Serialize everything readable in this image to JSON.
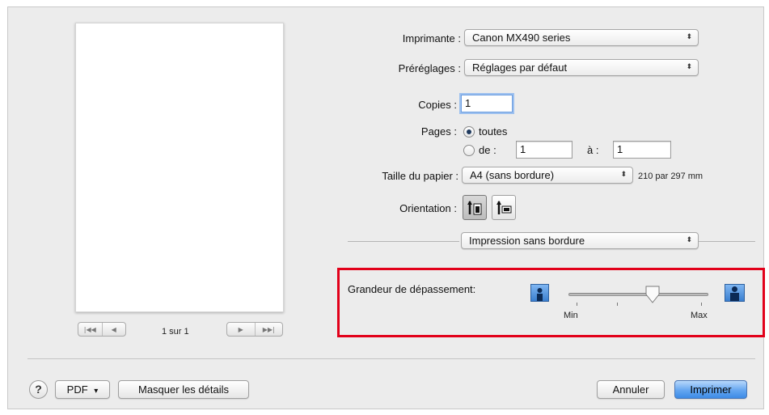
{
  "preview": {
    "nav_first": "|◀◀",
    "nav_prev": "◀",
    "nav_next": "▶",
    "nav_last": "▶▶|",
    "page_info": "1 sur 1"
  },
  "printer": {
    "label": "Imprimante :",
    "value": "Canon MX490 series"
  },
  "presets": {
    "label": "Préréglages :",
    "value": "Réglages par défaut"
  },
  "copies": {
    "label": "Copies :",
    "value": "1"
  },
  "pages": {
    "label": "Pages :",
    "all_label": "toutes",
    "from_label": "de :",
    "from_value": "1",
    "to_label": "à :",
    "to_value": "1",
    "selected": "toutes"
  },
  "paper_size": {
    "label": "Taille du papier :",
    "value": "A4 (sans bordure)",
    "dimensions": "210 par 297 mm"
  },
  "orientation": {
    "label": "Orientation :",
    "selected": "portrait"
  },
  "section_popup": {
    "value": "Impression sans bordure"
  },
  "extension": {
    "label": "Grandeur de dépassement:",
    "min_label": "Min",
    "max_label": "Max",
    "level": 0.6
  },
  "bottom": {
    "help": "?",
    "pdf_label": "PDF",
    "pdf_arrow": "▾",
    "hide_details": "Masquer les détails",
    "cancel": "Annuler",
    "print": "Imprimer"
  },
  "colors": {
    "highlight": "#e2001a",
    "accent": "#3d8be6"
  },
  "icons": [
    "popup-arrows-icon",
    "portrait-orientation-icon",
    "landscape-orientation-icon",
    "small-overhang-icon",
    "large-overhang-icon",
    "slider-thumb-icon",
    "help-icon"
  ]
}
